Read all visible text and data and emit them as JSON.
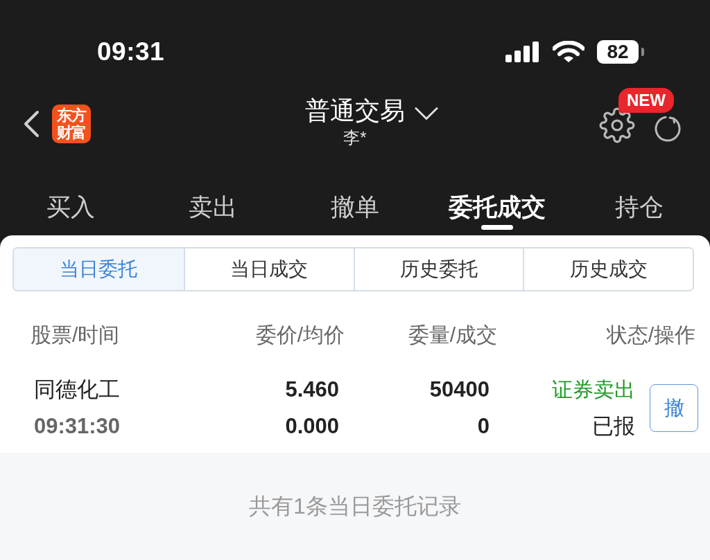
{
  "status_bar": {
    "time": "09:31",
    "battery": "82"
  },
  "header": {
    "logo": "东方财富",
    "title": "普通交易",
    "subtitle": "李*",
    "badge": "NEW"
  },
  "tabs": [
    {
      "label": "买入",
      "selected": false
    },
    {
      "label": "卖出",
      "selected": false
    },
    {
      "label": "撤单",
      "selected": false
    },
    {
      "label": "委托成交",
      "selected": true
    },
    {
      "label": "持仓",
      "selected": false
    }
  ],
  "segments": [
    {
      "label": "当日委托",
      "selected": true
    },
    {
      "label": "当日成交",
      "selected": false
    },
    {
      "label": "历史委托",
      "selected": false
    },
    {
      "label": "历史成交",
      "selected": false
    }
  ],
  "table": {
    "columns": [
      "股票/时间",
      "委价/均价",
      "委量/成交",
      "状态/操作"
    ],
    "rows": [
      {
        "stock": "同德化工",
        "time": "09:31:30",
        "order_price": "5.460",
        "avg_price": "0.000",
        "order_qty": "50400",
        "filled_qty": "0",
        "direction": "证券卖出",
        "color": "#1f9a25",
        "status": "已报",
        "action": "撤"
      }
    ]
  },
  "footer": "共有1条当日委托记录"
}
